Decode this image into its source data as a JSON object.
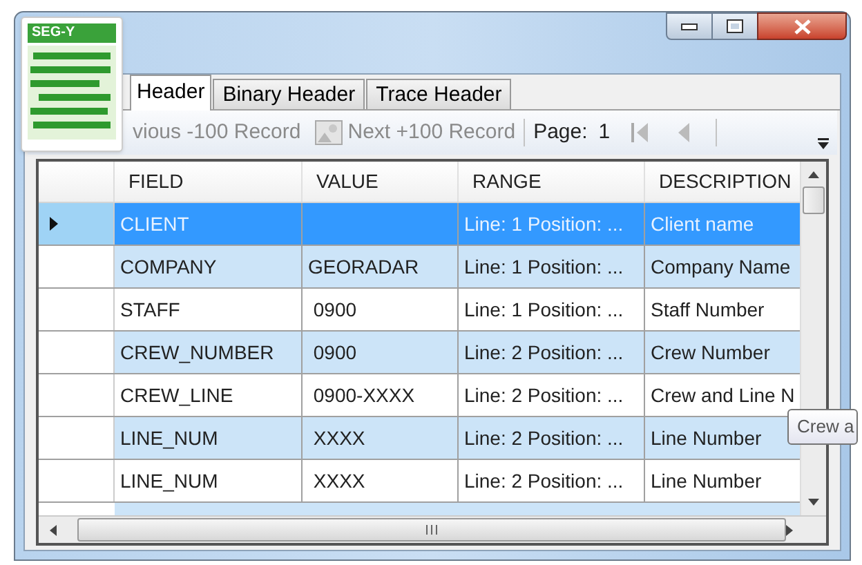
{
  "app_icon": {
    "label": "SEG-Y"
  },
  "tabs": [
    {
      "label": "Header",
      "selected": true
    },
    {
      "label": "Binary Header",
      "selected": false
    },
    {
      "label": "Trace Header",
      "selected": false
    }
  ],
  "toolbar": {
    "previous_button": "vious -100 Record",
    "next_button": "Next +100 Record",
    "page_label": "Page:",
    "page_value": "1"
  },
  "table": {
    "columns": [
      "FIELD",
      "VALUE",
      "RANGE",
      "DESCRIPTION"
    ],
    "rows": [
      {
        "selected": true,
        "cells": [
          "CLIENT",
          "",
          "Line: 1 Position: ...",
          "Client name"
        ]
      },
      {
        "selected": false,
        "cells": [
          "COMPANY",
          "GEORADAR",
          "Line: 1 Position: ...",
          "Company Name"
        ]
      },
      {
        "selected": false,
        "cells": [
          "STAFF",
          " 0900",
          "Line: 1 Position: ...",
          "Staff Number"
        ]
      },
      {
        "selected": false,
        "cells": [
          "CREW_NUMBER",
          " 0900",
          "Line: 2 Position: ...",
          "Crew Number"
        ]
      },
      {
        "selected": false,
        "cells": [
          "CREW_LINE",
          " 0900-XXXX",
          "Line: 2 Position: ...",
          "Crew and Line N"
        ]
      },
      {
        "selected": false,
        "cells": [
          "LINE_NUM",
          " XXXX",
          "Line: 2 Position: ...",
          "Line Number"
        ]
      },
      {
        "selected": false,
        "cells": [
          "LINE_NUM",
          " XXXX",
          "Line: 2 Position: ...",
          "Line Number"
        ]
      }
    ]
  },
  "tooltip": {
    "text": "Crew a"
  }
}
